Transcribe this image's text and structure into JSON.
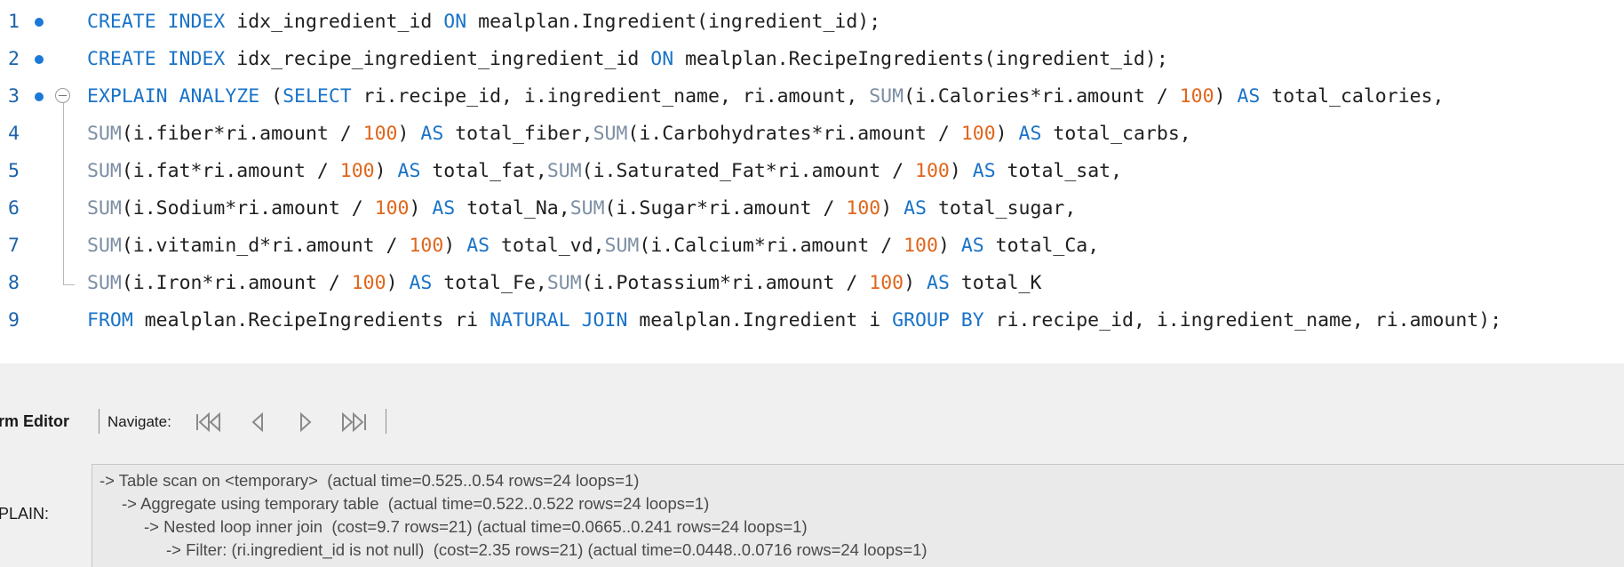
{
  "editor": {
    "lines": [
      {
        "number": "1",
        "has_dot": true,
        "fold": "none",
        "tokens": [
          {
            "t": "CREATE INDEX",
            "c": "kw"
          },
          {
            "t": " idx_ingredient_id ",
            "c": "id"
          },
          {
            "t": "ON",
            "c": "kw"
          },
          {
            "t": " mealplan.Ingredient(ingredient_id);",
            "c": "id"
          }
        ]
      },
      {
        "number": "2",
        "has_dot": true,
        "fold": "none",
        "tokens": [
          {
            "t": "CREATE INDEX",
            "c": "kw"
          },
          {
            "t": " idx_recipe_ingredient_ingredient_id ",
            "c": "id"
          },
          {
            "t": "ON",
            "c": "kw"
          },
          {
            "t": " mealplan.RecipeIngredients(ingredient_id);",
            "c": "id"
          }
        ]
      },
      {
        "number": "3",
        "has_dot": true,
        "fold": "start",
        "tokens": [
          {
            "t": "EXPLAIN ANALYZE",
            "c": "kw"
          },
          {
            "t": " (",
            "c": "id"
          },
          {
            "t": "SELECT",
            "c": "kw"
          },
          {
            "t": " ri.recipe_id, i.ingredient_name, ri.amount, ",
            "c": "id"
          },
          {
            "t": "SUM",
            "c": "fn"
          },
          {
            "t": "(i.Calories*ri.amount / ",
            "c": "id"
          },
          {
            "t": "100",
            "c": "num"
          },
          {
            "t": ") ",
            "c": "id"
          },
          {
            "t": "AS",
            "c": "kw"
          },
          {
            "t": " total_calories,",
            "c": "id"
          }
        ]
      },
      {
        "number": "4",
        "has_dot": false,
        "fold": "inner",
        "tokens": [
          {
            "t": "SUM",
            "c": "fn"
          },
          {
            "t": "(i.fiber*ri.amount / ",
            "c": "id"
          },
          {
            "t": "100",
            "c": "num"
          },
          {
            "t": ") ",
            "c": "id"
          },
          {
            "t": "AS",
            "c": "kw"
          },
          {
            "t": " total_fiber,",
            "c": "id"
          },
          {
            "t": "SUM",
            "c": "fn"
          },
          {
            "t": "(i.Carbohydrates*ri.amount / ",
            "c": "id"
          },
          {
            "t": "100",
            "c": "num"
          },
          {
            "t": ") ",
            "c": "id"
          },
          {
            "t": "AS",
            "c": "kw"
          },
          {
            "t": " total_carbs,",
            "c": "id"
          }
        ]
      },
      {
        "number": "5",
        "has_dot": false,
        "fold": "inner",
        "tokens": [
          {
            "t": "SUM",
            "c": "fn"
          },
          {
            "t": "(i.fat*ri.amount / ",
            "c": "id"
          },
          {
            "t": "100",
            "c": "num"
          },
          {
            "t": ") ",
            "c": "id"
          },
          {
            "t": "AS",
            "c": "kw"
          },
          {
            "t": " total_fat,",
            "c": "id"
          },
          {
            "t": "SUM",
            "c": "fn"
          },
          {
            "t": "(i.Saturated_Fat*ri.amount / ",
            "c": "id"
          },
          {
            "t": "100",
            "c": "num"
          },
          {
            "t": ") ",
            "c": "id"
          },
          {
            "t": "AS",
            "c": "kw"
          },
          {
            "t": " total_sat,",
            "c": "id"
          }
        ]
      },
      {
        "number": "6",
        "has_dot": false,
        "fold": "inner",
        "tokens": [
          {
            "t": "SUM",
            "c": "fn"
          },
          {
            "t": "(i.Sodium*ri.amount / ",
            "c": "id"
          },
          {
            "t": "100",
            "c": "num"
          },
          {
            "t": ") ",
            "c": "id"
          },
          {
            "t": "AS",
            "c": "kw"
          },
          {
            "t": " total_Na,",
            "c": "id"
          },
          {
            "t": "SUM",
            "c": "fn"
          },
          {
            "t": "(i.Sugar*ri.amount / ",
            "c": "id"
          },
          {
            "t": "100",
            "c": "num"
          },
          {
            "t": ") ",
            "c": "id"
          },
          {
            "t": "AS",
            "c": "kw"
          },
          {
            "t": " total_sugar,",
            "c": "id"
          }
        ]
      },
      {
        "number": "7",
        "has_dot": false,
        "fold": "inner",
        "tokens": [
          {
            "t": "SUM",
            "c": "fn"
          },
          {
            "t": "(i.vitamin_d*ri.amount / ",
            "c": "id"
          },
          {
            "t": "100",
            "c": "num"
          },
          {
            "t": ") ",
            "c": "id"
          },
          {
            "t": "AS",
            "c": "kw"
          },
          {
            "t": " total_vd,",
            "c": "id"
          },
          {
            "t": "SUM",
            "c": "fn"
          },
          {
            "t": "(i.Calcium*ri.amount / ",
            "c": "id"
          },
          {
            "t": "100",
            "c": "num"
          },
          {
            "t": ") ",
            "c": "id"
          },
          {
            "t": "AS",
            "c": "kw"
          },
          {
            "t": " total_Ca,",
            "c": "id"
          }
        ]
      },
      {
        "number": "8",
        "has_dot": false,
        "fold": "end",
        "tokens": [
          {
            "t": "SUM",
            "c": "fn"
          },
          {
            "t": "(i.Iron*ri.amount / ",
            "c": "id"
          },
          {
            "t": "100",
            "c": "num"
          },
          {
            "t": ") ",
            "c": "id"
          },
          {
            "t": "AS",
            "c": "kw"
          },
          {
            "t": " total_Fe,",
            "c": "id"
          },
          {
            "t": "SUM",
            "c": "fn"
          },
          {
            "t": "(i.Potassium*ri.amount / ",
            "c": "id"
          },
          {
            "t": "100",
            "c": "num"
          },
          {
            "t": ") ",
            "c": "id"
          },
          {
            "t": "AS",
            "c": "kw"
          },
          {
            "t": " total_K",
            "c": "id"
          }
        ]
      },
      {
        "number": "9",
        "has_dot": false,
        "fold": "none",
        "tokens": [
          {
            "t": "FROM",
            "c": "kw"
          },
          {
            "t": " mealplan.RecipeIngredients ri ",
            "c": "id"
          },
          {
            "t": "NATURAL JOIN",
            "c": "kw"
          },
          {
            "t": " mealplan.Ingredient i ",
            "c": "id"
          },
          {
            "t": "GROUP BY",
            "c": "kw"
          },
          {
            "t": " ri.recipe_id, i.ingredient_name, ri.amount);",
            "c": "id"
          }
        ]
      }
    ]
  },
  "toolbar": {
    "title": "orm Editor",
    "navigate_label": "Navigate:",
    "buttons": [
      "first-icon",
      "previous-icon",
      "next-icon",
      "last-icon"
    ]
  },
  "form": {
    "field_label": "XPLAIN:",
    "explain_lines": [
      "-> Table scan on <temporary>  (actual time=0.525..0.54 rows=24 loops=1)",
      "-> Aggregate using temporary table  (actual time=0.522..0.522 rows=24 loops=1)",
      "-> Nested loop inner join  (cost=9.7 rows=21) (actual time=0.0665..0.241 rows=24 loops=1)",
      "-> Filter: (ri.ingredient_id is not null)  (cost=2.35 rows=21) (actual time=0.0448..0.0716 rows=24 loops=1)"
    ]
  },
  "colors": {
    "keyword": "#1a73c8",
    "function": "#7c8ea3",
    "number": "#e0661b",
    "identifier": "#202020",
    "line_number": "#1d63a9",
    "statement_dot": "#1a78d8",
    "panel_bg": "#f0f0f0",
    "explain_text": "#4a4a4a"
  }
}
